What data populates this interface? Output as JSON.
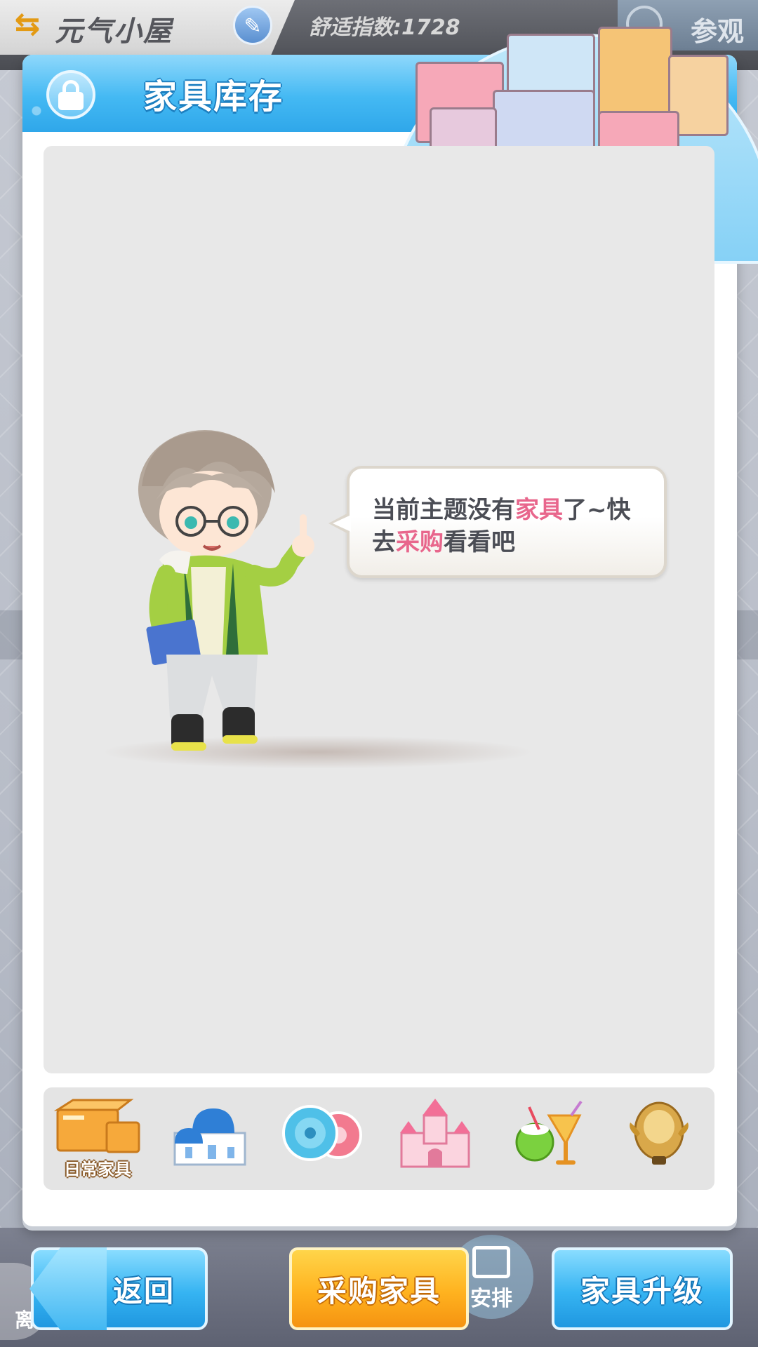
{
  "background": {
    "left_icon_label": "离",
    "mid_icon_label": "安排"
  },
  "topbar": {
    "swap_icon": "swap-arrows-icon",
    "title": "元气小屋",
    "edit_icon": "pencil-icon",
    "comfort": "舒适指数:1728",
    "visit_label": "参观",
    "visit_icon": "house-visit-icon"
  },
  "panel": {
    "title": "家具库存",
    "lock_icon": "lock-icon",
    "speech": {
      "part1": "当前主题没有",
      "highlight1": "家具",
      "part2": "了~快去",
      "highlight2": "采购",
      "part3": "看看吧"
    },
    "categories": [
      {
        "icon": "box-icon",
        "label": "日常家具",
        "selected": true
      },
      {
        "icon": "blue-dome-house-icon"
      },
      {
        "icon": "gear-fan-icon"
      },
      {
        "icon": "castle-icon"
      },
      {
        "icon": "coconut-drink-icon"
      },
      {
        "icon": "golden-helmet-icon"
      }
    ]
  },
  "buttons": {
    "back": "返回",
    "buy": "采购家具",
    "upgrade": "家具升级"
  },
  "colors": {
    "highlight": "#e8668c",
    "header_blue": "#44b9f3",
    "buy_orange": "#ffb21f",
    "title_brown": "#e39a14"
  }
}
